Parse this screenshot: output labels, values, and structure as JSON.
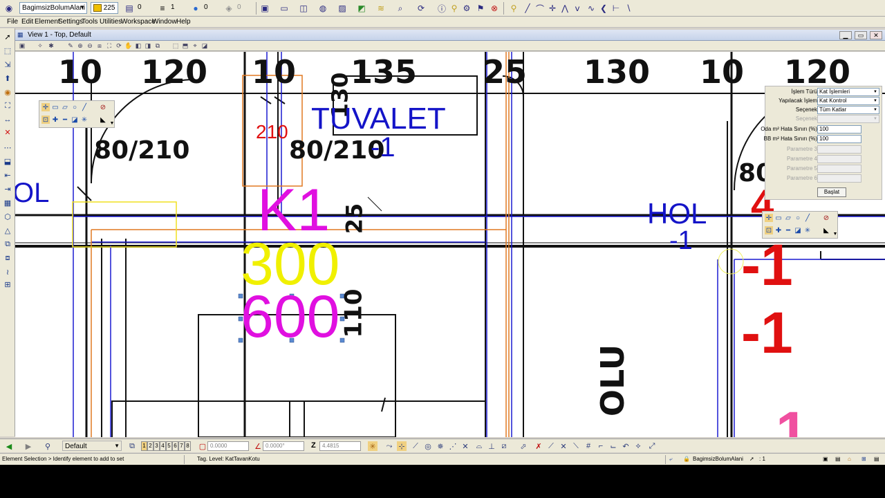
{
  "toolbar": {
    "level_combo": "BagimsizBolumAlani",
    "color_value": "225",
    "line_style_value": "0",
    "line_weight_value": "1",
    "transparency_value": "0",
    "priority_value": "0"
  },
  "menu": [
    "File",
    "Edit",
    "Element",
    "Settings",
    "Tools",
    "Utilities",
    "Workspace",
    "Window",
    "Help"
  ],
  "view": {
    "title": "View 1 - Top, Default"
  },
  "drawing": {
    "dims_top": [
      "10",
      "120",
      "10",
      "135",
      "25",
      "130",
      "10",
      "120"
    ],
    "door_labels": [
      "80/210",
      "80/210",
      "80"
    ],
    "vertical_dims": [
      "130",
      "25",
      "110"
    ],
    "room_labels": {
      "tuvalet": "TUVALET",
      "tuvalet_level": "-1",
      "hol_left": "OL",
      "hol": "HOL",
      "hol_level": "-1",
      "olu": "OLU"
    },
    "annotations": {
      "k1": "K1",
      "val_300": "300",
      "val_600": "600",
      "val_210": "210",
      "red_1": "-1",
      "red_2": "-1",
      "red_top": "4",
      "pink_bottom": "1"
    },
    "colors": {
      "blue": "#1414c8",
      "magenta": "#e010e0",
      "yellow": "#f0f000",
      "red": "#e01010",
      "orange": "#e08020",
      "pink": "#f050a0"
    }
  },
  "props_panel": {
    "rows": [
      {
        "label": "İşlem Türü",
        "value": "Kat İşlemleri",
        "type": "select",
        "enabled": true
      },
      {
        "label": "Yapılacak İşlem",
        "value": "Kat Kontrol",
        "type": "select",
        "enabled": true
      },
      {
        "label": "Seçenek",
        "value": "Tüm Katlar",
        "type": "select",
        "enabled": true
      },
      {
        "label": "Seçenek",
        "value": "",
        "type": "select",
        "enabled": false
      },
      {
        "label": "Oda m² Hata Sınırı (%)",
        "value": "100",
        "type": "text",
        "enabled": true
      },
      {
        "label": "BB m² Hata Sınırı (%)",
        "value": "100",
        "type": "text",
        "enabled": true
      },
      {
        "label": "Parametre 3",
        "value": "",
        "type": "text",
        "enabled": false
      },
      {
        "label": "Parametre 4",
        "value": "",
        "type": "text",
        "enabled": false
      },
      {
        "label": "Parametre 5",
        "value": "",
        "type": "text",
        "enabled": false
      },
      {
        "label": "Parametre 6",
        "value": "",
        "type": "text",
        "enabled": false
      }
    ],
    "start_button": "Başlat"
  },
  "bottom_toolbar": {
    "view_group": "Default",
    "view_numbers": [
      "1",
      "2",
      "3",
      "4",
      "5",
      "6",
      "7",
      "8"
    ],
    "x_field": "0.0000",
    "angle_field": "0.0000°",
    "z_label": "Z",
    "z_field": "4.4815"
  },
  "status": {
    "prompt": "Element Selection > Identify element to add to set",
    "tag": "Tag. Level: KatTavanKotu",
    "level": "BagimsizBolumAlani",
    "selection": ": 1"
  }
}
